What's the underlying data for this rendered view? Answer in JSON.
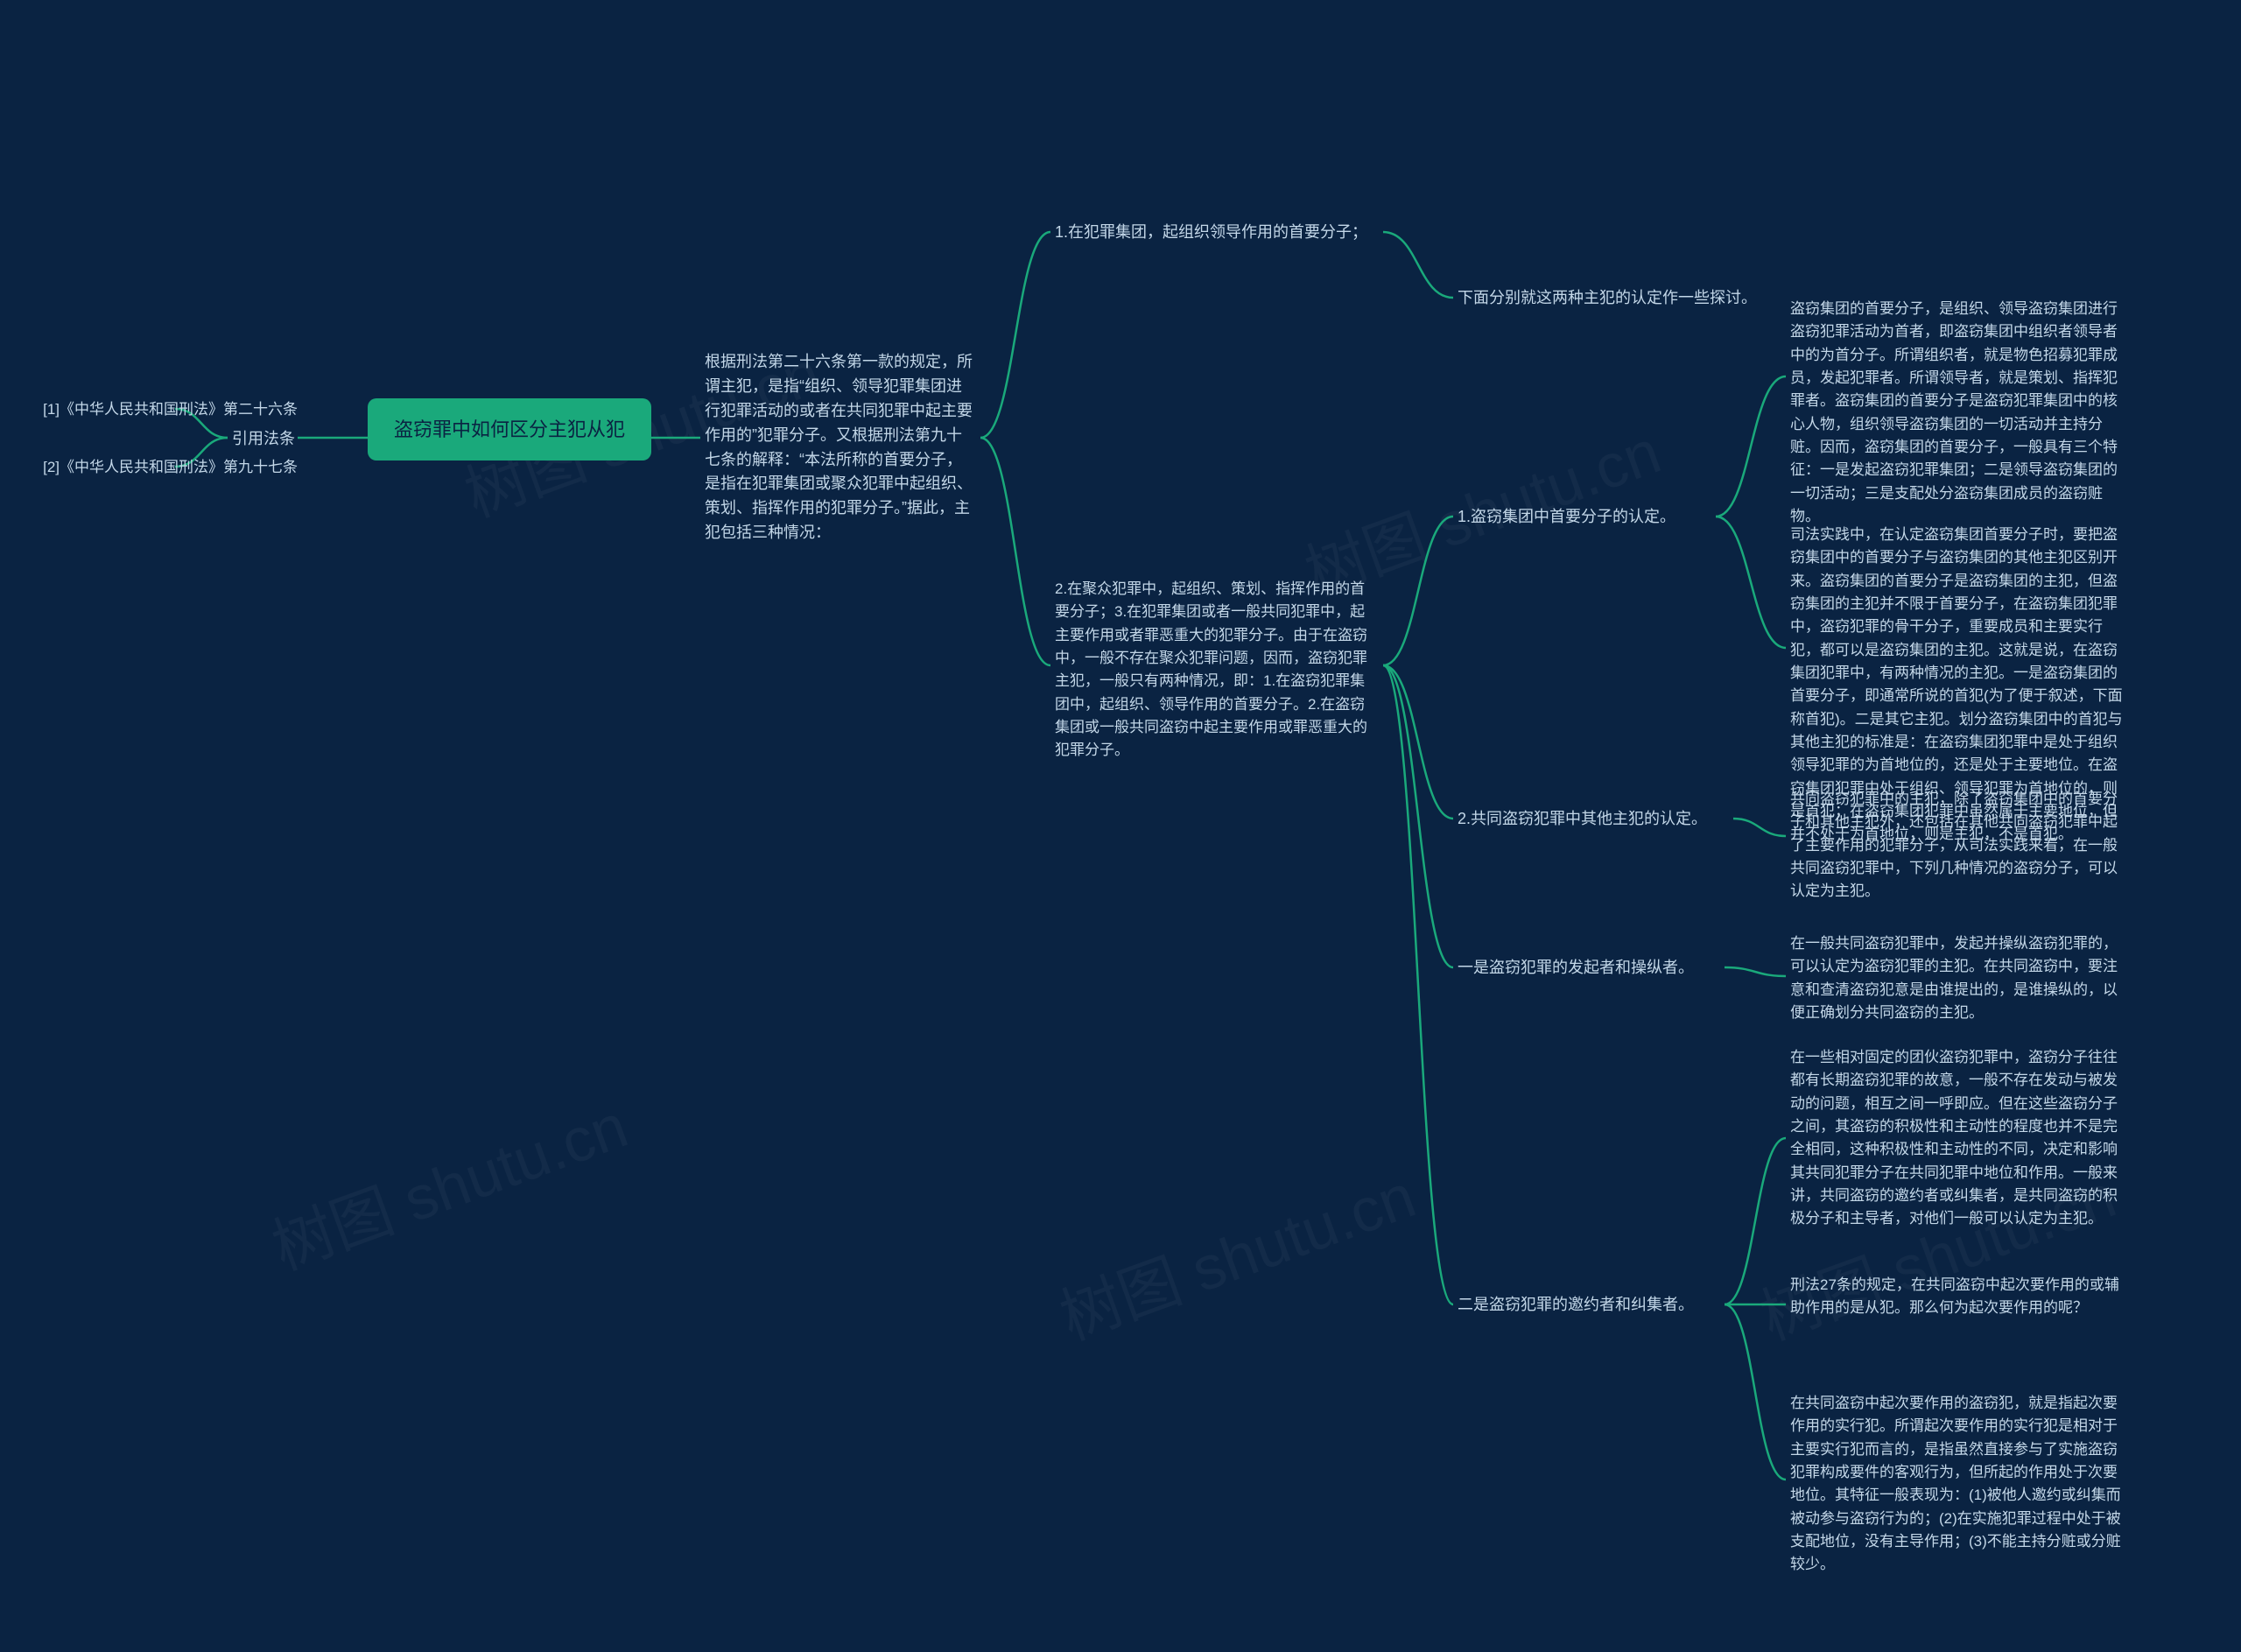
{
  "watermark": "树图 shutu.cn",
  "root": "盗窃罪中如何区分主犯从犯",
  "left": {
    "citeHead": "引用法条",
    "cite1": "[1]《中华人民共和国刑法》第二十六条",
    "cite2": "[2]《中华人民共和国刑法》第九十七条"
  },
  "n1": "根据刑法第二十六条第一款的规定，所谓主犯，是指“组织、领导犯罪集团进行犯罪活动的或者在共同犯罪中起主要作用的”犯罪分子。又根据刑法第九十七条的解释：“本法所称的首要分子，是指在犯罪集团或聚众犯罪中起组织、策划、指挥作用的犯罪分子。”据此，主犯包括三种情况：",
  "n1a": "1.在犯罪集团，起组织领导作用的首要分子；",
  "n1b": "2.在聚众犯罪中，起组织、策划、指挥作用的首要分子；3.在犯罪集团或者一般共同犯罪中，起主要作用或者罪恶重大的犯罪分子。由于在盗窃中，一般不存在聚众犯罪问题，因而，盗窃犯罪主犯，一般只有两种情况，即：1.在盗窃犯罪集团中，起组织、领导作用的首要分子。2.在盗窃集团或一般共同盗窃中起主要作用或罪恶重大的犯罪分子。",
  "n2intro": "下面分别就这两种主犯的认定作一些探讨。",
  "n2_1_title": "1.盗窃集团中首要分子的认定。",
  "n2_1_body1": "盗窃集团的首要分子，是组织、领导盗窃集团进行盗窃犯罪活动为首者，即盗窃集团中组织者领导者中的为首分子。所谓组织者，就是物色招募犯罪成员，发起犯罪者。所谓领导者，就是策划、指挥犯罪者。盗窃集团的首要分子是盗窃犯罪集团中的核心人物，组织领导盗窃集团的一切活动并主持分赃。因而，盗窃集团的首要分子，一般具有三个特征：一是发起盗窃犯罪集团；二是领导盗窃集团的一切活动；三是支配处分盗窃集团成员的盗窃赃物。",
  "n2_1_body2": "司法实践中，在认定盗窃集团首要分子时，要把盗窃集团中的首要分子与盗窃集团的其他主犯区别开来。盗窃集团的首要分子是盗窃集团的主犯，但盗窃集团的主犯并不限于首要分子，在盗窃集团犯罪中，盗窃犯罪的骨干分子，重要成员和主要实行犯，都可以是盗窃集团的主犯。这就是说，在盗窃集团犯罪中，有两种情况的主犯。一是盗窃集团的首要分子，即通常所说的首犯(为了便于叙述，下面称首犯)。二是其它主犯。划分盗窃集团中的首犯与其他主犯的标准是：在盗窃集团犯罪中是处于组织领导犯罪的为首地位的，还是处于主要地位。在盗窃集团犯罪中处于组织、领导犯罪为首地位的，则是首犯；在盗窃集团犯罪中虽然属于主要地位，但并不处于为首地位，则是主犯，不是首犯。",
  "n2_2_title": "2.共同盗窃犯罪中其他主犯的认定。",
  "n2_2_body": "共同盗窃犯罪中的主犯，除了盗窃集团中的首要分子和其他主犯外，还包括在其他共同盗窃犯罪中起了主要作用的犯罪分子，从司法实践来看，在一般共同盗窃犯罪中，下列几种情况的盗窃分子，可以认定为主犯。",
  "n2_3_title": "一是盗窃犯罪的发起者和操纵者。",
  "n2_3_body": "在一般共同盗窃犯罪中，发起并操纵盗窃犯罪的，可以认定为盗窃犯罪的主犯。在共同盗窃中，要注意和查清盗窃犯意是由谁提出的，是谁操纵的，以便正确划分共同盗窃的主犯。",
  "n2_4_title": "二是盗窃犯罪的邀约者和纠集者。",
  "n2_4_body1": "在一些相对固定的团伙盗窃犯罪中，盗窃分子往往都有长期盗窃犯罪的故意，一般不存在发动与被发动的问题，相互之间一呼即应。但在这些盗窃分子之间，其盗窃的积极性和主动性的程度也并不是完全相同，这种积极性和主动性的不同，决定和影响其共同犯罪分子在共同犯罪中地位和作用。一般来讲，共同盗窃的邀约者或纠集者，是共同盗窃的积极分子和主导者，对他们一般可以认定为主犯。",
  "n2_4_body2": "刑法27条的规定，在共同盗窃中起次要作用的或辅助作用的是从犯。那么何为起次要作用的呢？",
  "n2_4_body3": "在共同盗窃中起次要作用的盗窃犯，就是指起次要作用的实行犯。所谓起次要作用的实行犯是相对于主要实行犯而言的，是指虽然直接参与了实施盗窃犯罪构成要件的客观行为，但所起的作用处于次要地位。其特征一般表现为：(1)被他人邀约或纠集而被动参与盗窃行为的；(2)在实施犯罪过程中处于被支配地位，没有主导作用；(3)不能主持分赃或分赃较少。"
}
